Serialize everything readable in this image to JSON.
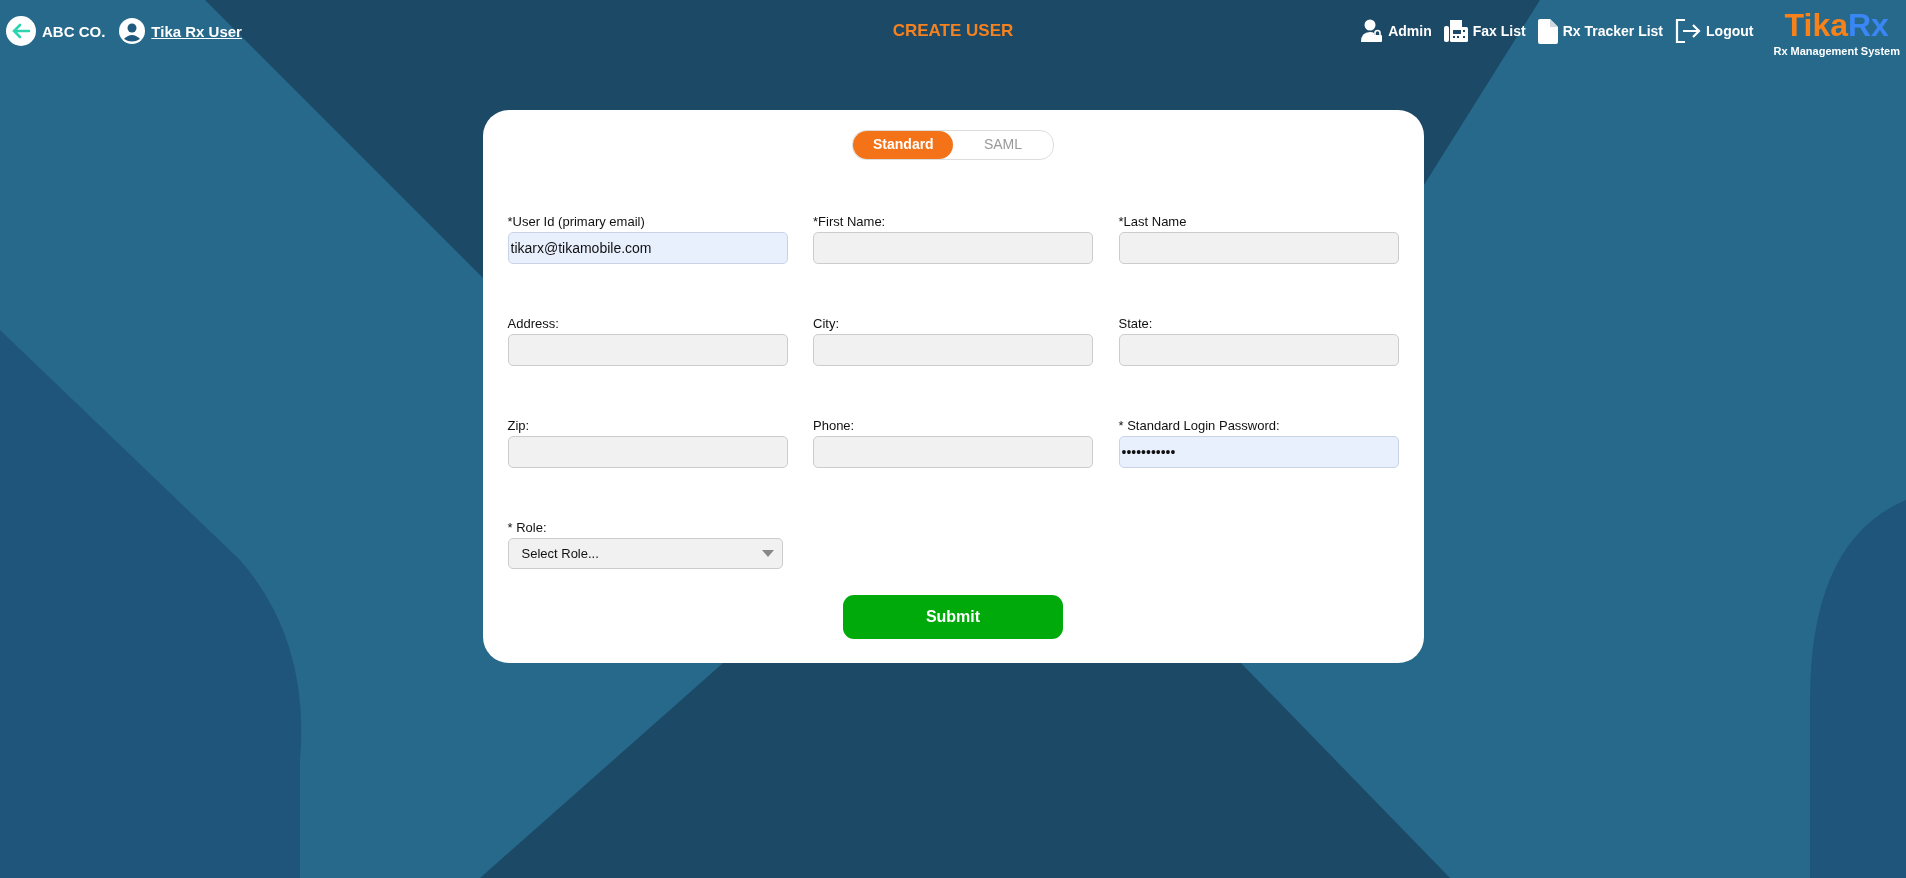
{
  "header": {
    "back_label": "ABC CO.",
    "user_label": "Tika Rx User",
    "title": "CREATE USER",
    "nav": [
      {
        "kind": "admin",
        "label": "Admin"
      },
      {
        "kind": "fax",
        "label": "Fax List"
      },
      {
        "kind": "document",
        "label": "Rx Tracker List"
      },
      {
        "kind": "logout",
        "label": "Logout"
      }
    ],
    "logo": {
      "part_1": "Tika",
      "part_2": "Rx",
      "subtitle": "Rx Management System"
    }
  },
  "form": {
    "tabs": [
      {
        "label": "Standard",
        "selected": true
      },
      {
        "label": "SAML",
        "selected": false
      }
    ],
    "fields": [
      {
        "kind": "text",
        "label": "*User Id (primary email)",
        "value": "tikarx@tikamobile.com",
        "autofilled": true
      },
      {
        "kind": "text",
        "label": "*First Name:",
        "autofilled": false
      },
      {
        "kind": "text",
        "label": "*Last Name",
        "autofilled": false
      },
      {
        "kind": "text",
        "label": "Address:",
        "autofilled": false
      },
      {
        "kind": "text",
        "label": "City:",
        "autofilled": false
      },
      {
        "kind": "text",
        "label": "State:",
        "autofilled": false
      },
      {
        "kind": "text",
        "label": "Zip:",
        "autofilled": false
      },
      {
        "kind": "text",
        "label": "Phone:",
        "autofilled": false
      },
      {
        "kind": "password",
        "label": "* Standard Login Password:",
        "value": "•••••••••••",
        "autofilled": true
      },
      {
        "kind": "select",
        "label": "* Role:",
        "value": "Select Role..."
      }
    ],
    "submit": "Submit"
  }
}
